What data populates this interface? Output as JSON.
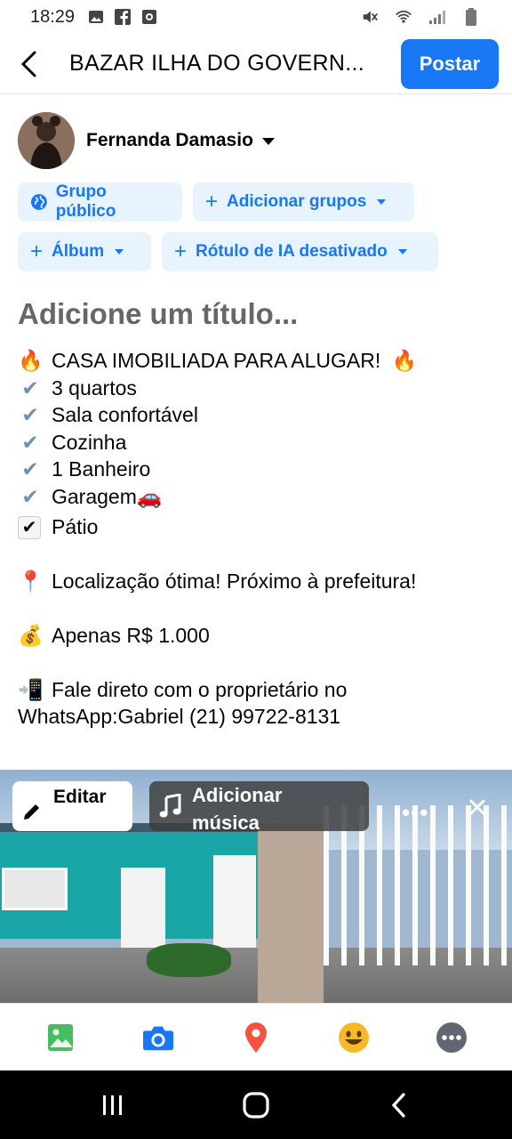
{
  "status_bar": {
    "time": "18:29",
    "left_icons": [
      "image-notification-icon",
      "facebook-notification-icon",
      "screen-record-icon"
    ],
    "right_icons": [
      "mute-icon",
      "wifi-icon",
      "signal-icon",
      "battery-icon"
    ]
  },
  "header": {
    "title": "BAZAR ILHA DO GOVERN...",
    "post_label": "Postar"
  },
  "author": {
    "name": "Fernanda Damasio"
  },
  "chips": {
    "public_group": "Grupo público",
    "add_groups": "Adicionar grupos",
    "album": "Álbum",
    "ai_label": "Rótulo de IA desativado"
  },
  "post": {
    "title_placeholder": "Adicione um título...",
    "lines": [
      {
        "emoji": "🔥",
        "text": "CASA IMOBILIADA PARA ALUGAR!",
        "trailing": "🔥"
      },
      {
        "emoji": "✔",
        "text": "3 quartos"
      },
      {
        "emoji": "✔",
        "text": "Sala confortável"
      },
      {
        "emoji": "✔",
        "text": "Cozinha"
      },
      {
        "emoji": "✔",
        "text": "1 Banheiro"
      },
      {
        "emoji": "✔",
        "text": "Garagem",
        "trailing": "🚗"
      },
      {
        "emoji": "✔",
        "text": "Pátio"
      },
      {
        "emoji": "📍",
        "text": "Localização ótima! Próximo à prefeitura!"
      },
      {
        "emoji": "💰",
        "text": "Apenas R$ 1.000"
      },
      {
        "emoji": "📲",
        "text": "Fale direto com o proprietário no"
      },
      {
        "text": "WhatsApp:Gabriel (21) 99722-8131"
      }
    ]
  },
  "photo": {
    "edit_label": "Editar",
    "music_label_line1": "Adicionar",
    "music_label_line2": "música",
    "more_label": "•••",
    "close_label": "✕"
  },
  "toolbar": {
    "items": [
      "photo-icon",
      "camera-icon",
      "location-icon",
      "feeling-icon",
      "more-icon"
    ]
  },
  "colors": {
    "accent": "#1877f2",
    "chip_bg": "#e7f3ff",
    "photo_green": "#45bd62",
    "location_red": "#f5533d",
    "feeling_yellow": "#f7b928"
  }
}
